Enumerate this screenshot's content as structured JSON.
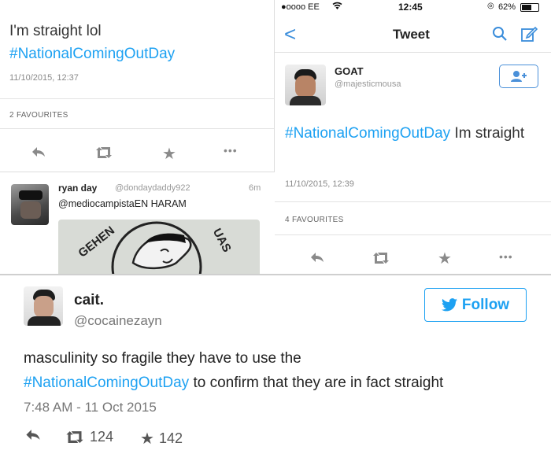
{
  "left_tweet": {
    "text": "I'm straight lol",
    "hashtag": "#NationalComingOutDay",
    "timestamp": "11/10/2015, 12:37",
    "favourites": "2 FAVOURITES",
    "actions": [
      "reply-icon",
      "retweet-icon",
      "favourite-star-icon",
      "more-icon"
    ]
  },
  "reply_tweet": {
    "name": "ryan day",
    "handle": "@dondaydaddy922",
    "time": "6m",
    "text": "@mediocampistaEN HARAM",
    "image_words": [
      "GEHEN",
      "UAS"
    ]
  },
  "right_tweet": {
    "status_bar": {
      "carrier": "●oooo EE",
      "time": "12:45",
      "battery": "62%"
    },
    "nav_title": "Tweet",
    "back_label": "<",
    "name": "GOAT",
    "handle": "@majesticmousa",
    "hashtag": "#NationalComingOutDay",
    "text_after": " Im straight",
    "timestamp": "11/10/2015, 12:39",
    "favourites": "4 FAVOURITES"
  },
  "bottom_tweet": {
    "name": "cait.",
    "handle": "@cocainezayn",
    "follow_label": "Follow",
    "text_before": "masculinity so fragile they have to use the ",
    "hashtag": "#NationalComingOutDay",
    "text_after": " to confirm that they are in fact straight",
    "timestamp": "7:48 AM - 11 Oct 2015",
    "retweets": "124",
    "likes": "142"
  },
  "colors": {
    "link": "#1da1f2",
    "muted": "#8a8a8a"
  }
}
